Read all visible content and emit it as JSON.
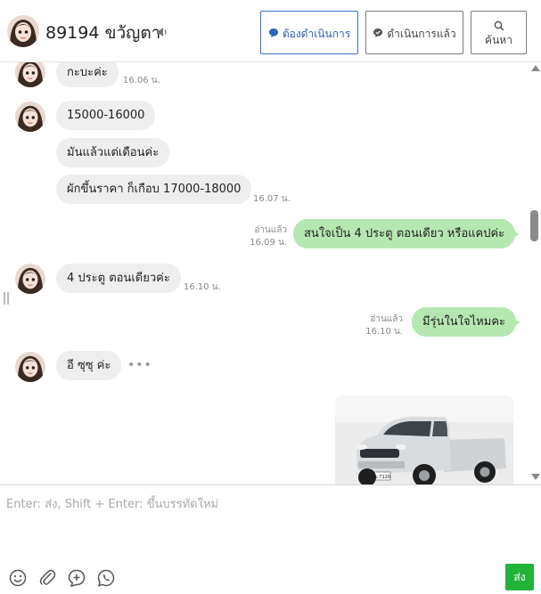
{
  "header": {
    "contact_name": "89194 ขวัญตา",
    "buttons": {
      "todo": "ต้องดำเนินการ",
      "done": "ดำเนินการแล้ว",
      "search": "ค้นหา"
    }
  },
  "messages": [
    {
      "from": "contact",
      "text": "กะบะค่ะ",
      "time": "16.06 น."
    },
    {
      "from": "contact",
      "text": "15000-16000"
    },
    {
      "from": "contact",
      "text": "มันแล้วแต่เดือนค่ะ"
    },
    {
      "from": "contact",
      "text": "ผักขึ้นราคา ก็เกือบ 17000-18000",
      "time": "16.07 น."
    },
    {
      "from": "agent",
      "text": "สนใจเป็น 4 ประตู ตอนเดียว หรือแคปค่ะ",
      "read": "อ่านแล้ว",
      "time": "16.09 น."
    },
    {
      "from": "contact",
      "text": "4 ประตู ตอนเดียวค่ะ",
      "time": "16.10 น."
    },
    {
      "from": "agent",
      "text": "มีรุ่นในใจไหมคะ",
      "read": "อ่านแล้ว",
      "time": "16.10 น."
    },
    {
      "from": "contact",
      "text": "อี ซุซุ ค่ะ"
    },
    {
      "from": "agent",
      "type": "image",
      "image": "white-pickup-truck",
      "plate": "ฌข 7120"
    }
  ],
  "composer": {
    "placeholder": "Enter: ส่ง, Shift + Enter: ขึ้นบรรทัดใหม่",
    "tools": [
      "emoji-icon",
      "attachment-icon",
      "add-icon",
      "whatsapp-icon"
    ],
    "send_label": "ส่ง"
  },
  "colors": {
    "incoming_bubble": "#eeeeef",
    "outgoing_bubble": "#b5e8b1",
    "send_button": "#23b33b",
    "primary_button_border": "#3a6fc4"
  }
}
